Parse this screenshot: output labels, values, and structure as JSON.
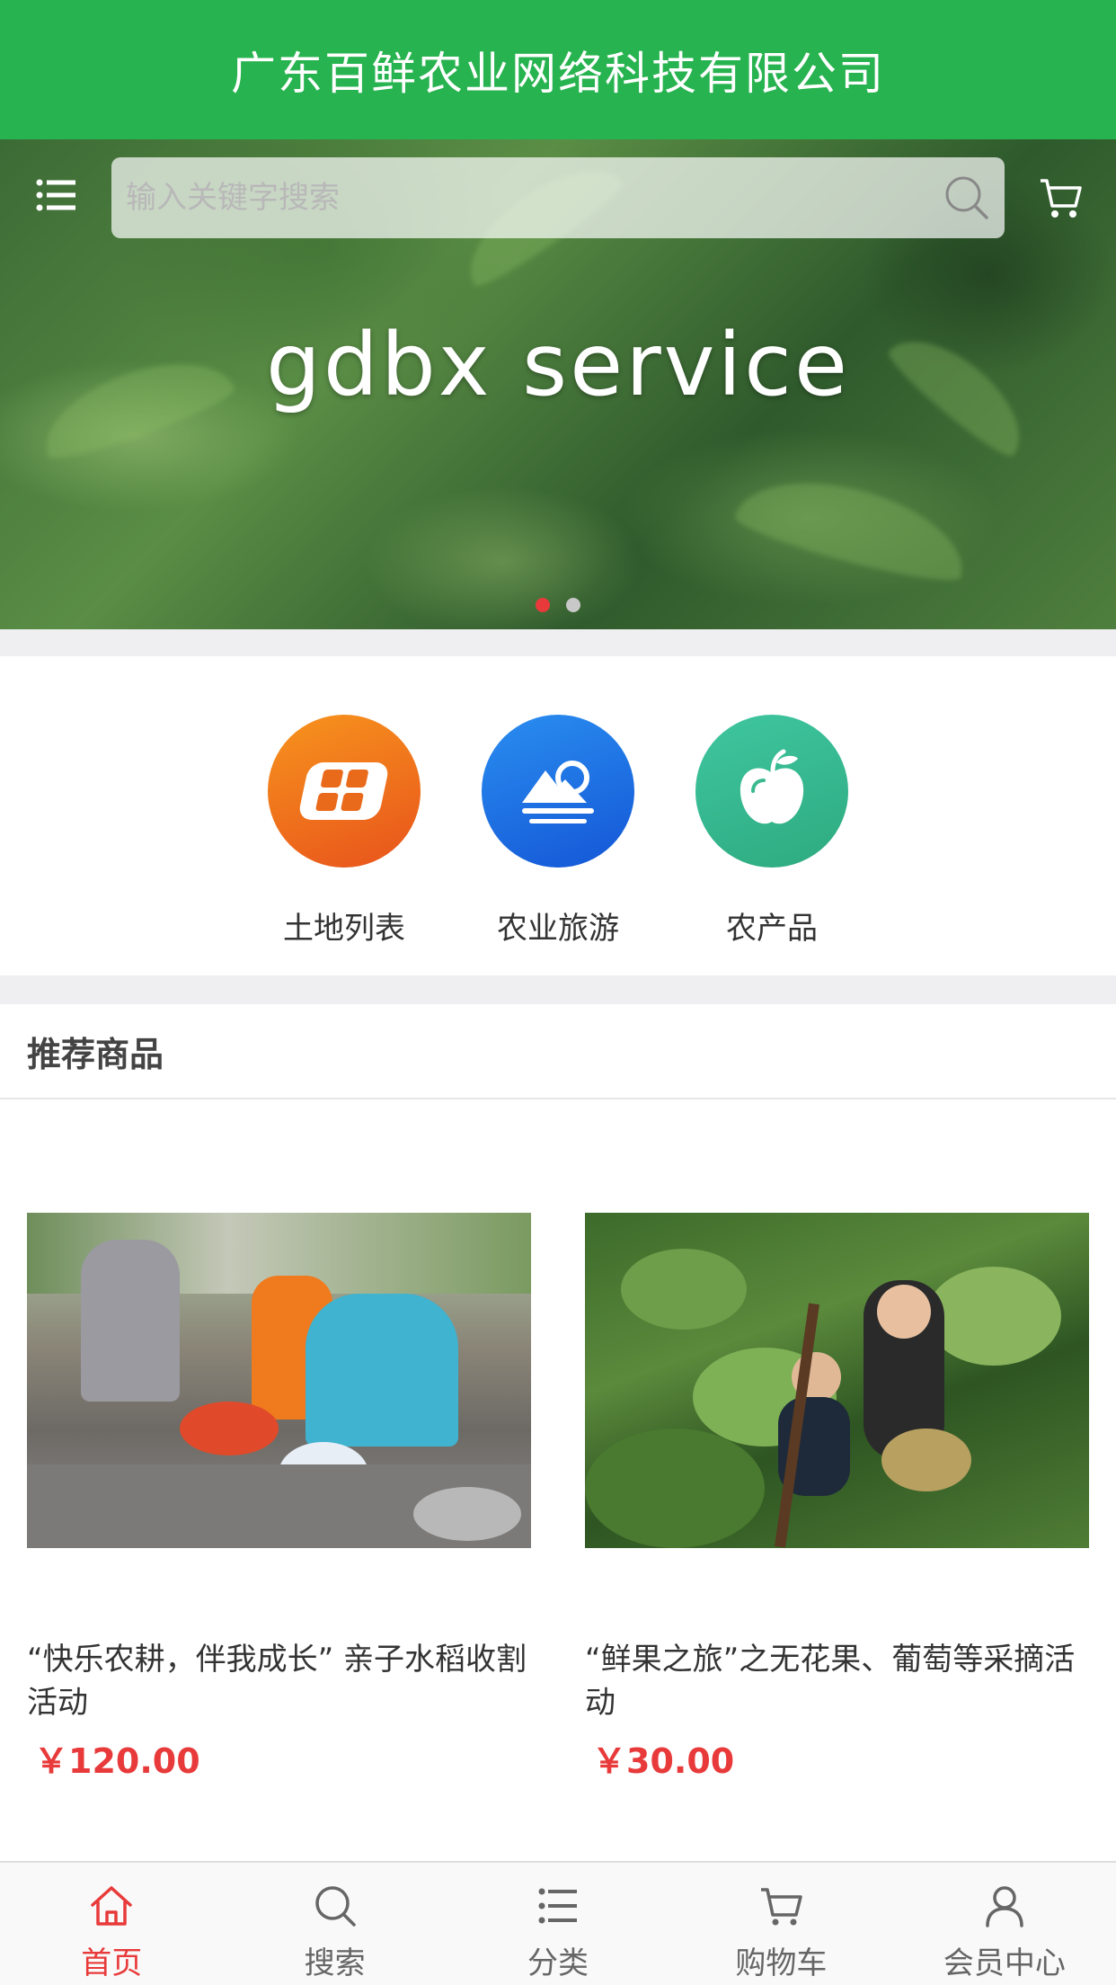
{
  "header": {
    "title": "广东百鲜农业网络科技有限公司"
  },
  "banner": {
    "text": "gdbx service",
    "search_placeholder": "输入关键字搜索",
    "slide_count": 2,
    "active_slide": 1
  },
  "categories": [
    {
      "label": "土地列表",
      "icon": "land-grid-icon",
      "color": "#ee6a1b"
    },
    {
      "label": "农业旅游",
      "icon": "landscape-icon",
      "color": "#1a73e0"
    },
    {
      "label": "农产品",
      "icon": "apple-icon",
      "color": "#38bb92"
    }
  ],
  "recommend": {
    "heading": "推荐商品",
    "products": [
      {
        "title": "“快乐农耕，伴我成长” 亲子水稻收割活动",
        "price": "￥120.00"
      },
      {
        "title": "“鲜果之旅”之无花果、葡萄等采摘活动",
        "price": "￥30.00"
      }
    ]
  },
  "tabbar": [
    {
      "label": "首页",
      "icon": "home-icon",
      "active": true
    },
    {
      "label": "搜索",
      "icon": "search-icon",
      "active": false
    },
    {
      "label": "分类",
      "icon": "list-icon",
      "active": false
    },
    {
      "label": "购物车",
      "icon": "cart-icon",
      "active": false
    },
    {
      "label": "会员中心",
      "icon": "user-icon",
      "active": false
    }
  ],
  "colors": {
    "brand_green": "#27b34f",
    "accent_red": "#e83a3a"
  }
}
